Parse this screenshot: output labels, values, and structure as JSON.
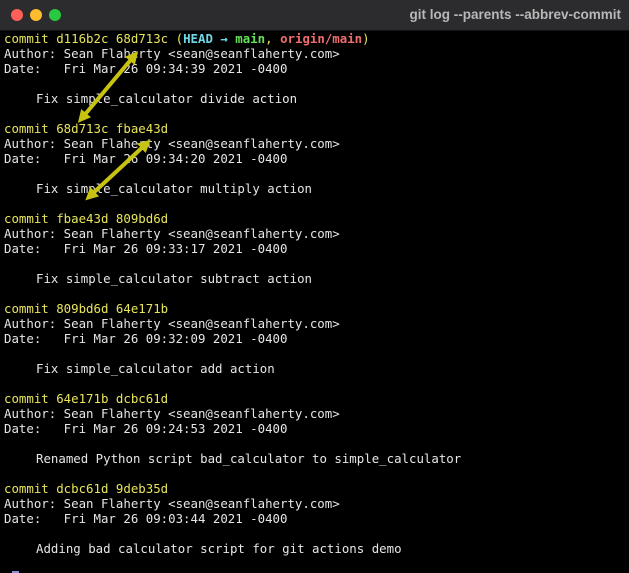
{
  "window": {
    "title": "git log --parents --abbrev-commit"
  },
  "colors": {
    "commit_hash": "#e8e55c",
    "head": "#6fd8e6",
    "branch": "#65e05a",
    "origin": "#ef6d6d",
    "arrow": "#c7c310"
  },
  "log": {
    "head_ref": {
      "open": "(",
      "head": "HEAD",
      "arrow": " → ",
      "branch": "main",
      "sep": ", ",
      "origin": "origin/main",
      "close": ")"
    },
    "commits": [
      {
        "header": "commit d116b2c 68d713c",
        "author": "Author: Sean Flaherty <sean@seanflaherty.com>",
        "date": "Date:   Fri Mar 26 09:34:39 2021 -0400",
        "message": "Fix simple_calculator divide action"
      },
      {
        "header": "commit 68d713c fbae43d",
        "author": "Author: Sean Flaherty <sean@seanflaherty.com>",
        "date": "Date:   Fri Mar 26 09:34:20 2021 -0400",
        "message": "Fix simple_calculator multiply action"
      },
      {
        "header": "commit fbae43d 809bd6d",
        "author": "Author: Sean Flaherty <sean@seanflaherty.com>",
        "date": "Date:   Fri Mar 26 09:33:17 2021 -0400",
        "message": "Fix simple_calculator subtract action"
      },
      {
        "header": "commit 809bd6d 64e171b",
        "author": "Author: Sean Flaherty <sean@seanflaherty.com>",
        "date": "Date:   Fri Mar 26 09:32:09 2021 -0400",
        "message": "Fix simple_calculator add action"
      },
      {
        "header": "commit 64e171b dcbc61d",
        "author": "Author: Sean Flaherty <sean@seanflaherty.com>",
        "date": "Date:   Fri Mar 26 09:24:53 2021 -0400",
        "message": "Renamed Python script bad_calculator to simple_calculator"
      },
      {
        "header": "commit dcbc61d 9deb35d",
        "author": "Author: Sean Flaherty <sean@seanflaherty.com>",
        "date": "Date:   Fri Mar 26 09:03:44 2021 -0400",
        "message": "Adding bad calculator script for git actions demo"
      }
    ],
    "prompt": ":"
  }
}
